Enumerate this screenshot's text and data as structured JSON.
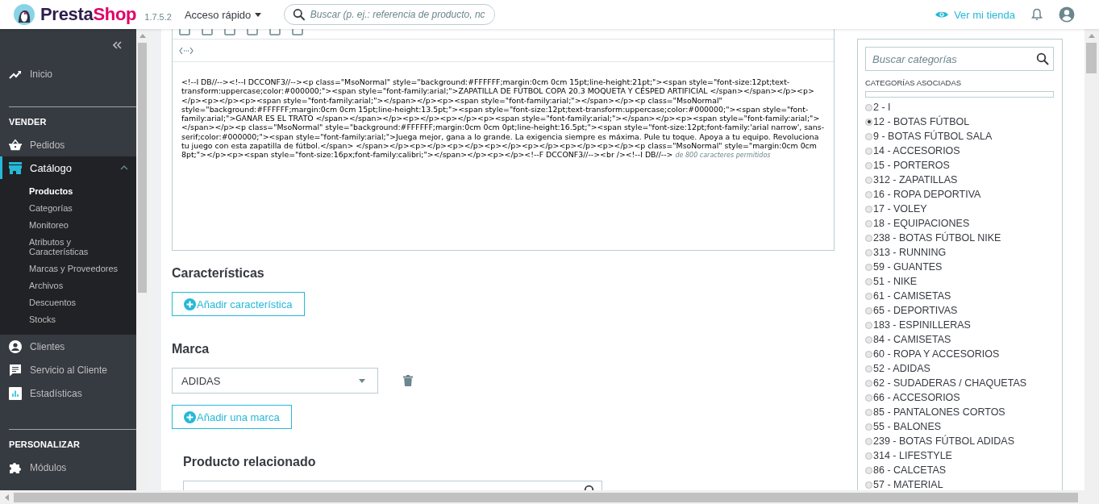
{
  "header": {
    "logo": [
      "Presta",
      "Shop"
    ],
    "version": "1.7.5.2",
    "quick_access": "Acceso rápido",
    "search": {
      "placeholder": "Buscar (p. ej.: referencia de producto, nc"
    },
    "view_store": "Ver mi tienda"
  },
  "sidebar": {
    "top": [
      {
        "label": "Inicio",
        "selected": false
      }
    ],
    "sections": [
      {
        "heading": "VENDER",
        "items": [
          {
            "label": "Pedidos",
            "selected": false,
            "expanded": false
          },
          {
            "label": "Catálogo",
            "selected": true,
            "expanded": true,
            "children": [
              {
                "label": "Productos",
                "selected": true
              },
              {
                "label": "Categorías",
                "selected": false
              },
              {
                "label": "Monitoreo",
                "selected": false
              },
              {
                "label": "Atributos y Características",
                "selected": false
              },
              {
                "label": "Marcas y Proveedores",
                "selected": false
              },
              {
                "label": "Archivos",
                "selected": false
              },
              {
                "label": "Descuentos",
                "selected": false
              },
              {
                "label": "Stocks",
                "selected": false
              }
            ]
          },
          {
            "label": "Clientes",
            "selected": false,
            "expanded": false
          },
          {
            "label": "Servicio al Cliente",
            "selected": false,
            "expanded": false
          },
          {
            "label": "Estadísticas",
            "selected": false,
            "expanded": false
          }
        ]
      },
      {
        "heading": "PERSONALIZAR",
        "items": [
          {
            "label": "Módulos",
            "selected": false,
            "expanded": false
          }
        ]
      }
    ]
  },
  "editor": {
    "source": "<!--I DB//--><!--I DCCONF3//--><p class=\"MsoNormal\" style=\"background:#FFFFFF;margin:0cm 0cm 15pt;line-height:21pt;\"><span style=\"font-size:12pt;text-transform:uppercase;color:#000000;\"><span style=\"font-family:arial;\">ZAPATILLA DE FÚTBOL COPA 20.3 MOQUETA Y CÉSPED ARTIFICIAL </span></span></p><p></p><p></p><p><span style=\"font-family:arial;\"></span></p><p><span style=\"font-family:arial;\"></span></p><p class=\"MsoNormal\" style=\"background:#FFFFFF;margin:0cm 0cm 15pt;line-height:13.5pt;\"><span style=\"font-size:12pt;text-transform:uppercase;color:#000000;\"><span style=\"font-family:arial;\">GANAR ES EL TRATO </span></span></p><p></p><p></p><p><span style=\"font-family:arial;\"></span></p><p><span style=\"font-family:arial;\"></span></p><p class=\"MsoNormal\" style=\"background:#FFFFFF;margin:0cm 0cm 0pt;line-height:16.5pt;\"><span style=\"font-size:12pt;font-family:'arial narrow', sans-serif;color:#000000;\"><span style=\"font-family:arial;\">Juega mejor, gana a lo grande. La exigencia siempre es máxima. Pule tu toque. Apoya a tu equipo. Revoluciona tu juego con esta zapatilla de fútbol.</span> </span></p><p></p><p></p><p></p><p></p><p></p><p></p><p class=\"MsoNormal\" style=\"margin:0cm 0cm 8pt;\"></p><p><span style=\"font-size:16px;font-family:calibri;\"></span></p><p></p><!--F DCCONF3//--><br /><!--I DB//-->",
    "counter": "de 800 caracteres permitidos"
  },
  "features": {
    "title": "Características",
    "add_button": "Añadir característica"
  },
  "brand": {
    "title": "Marca",
    "value": "ADIDAS",
    "add_button": "Añadir una marca"
  },
  "related": {
    "title": "Producto relacionado"
  },
  "categories": {
    "search": {
      "placeholder": "Buscar categorías"
    },
    "heading": "CATEGORÍAS ASOCIADAS",
    "items": [
      {
        "label": "2 - I",
        "selected": false
      },
      {
        "label": "12 - BOTAS FÚTBOL",
        "selected": true
      },
      {
        "label": "9 - BOTAS FÚTBOL SALA",
        "selected": false
      },
      {
        "label": "14 - ACCESORIOS",
        "selected": false
      },
      {
        "label": "15 - PORTEROS",
        "selected": false
      },
      {
        "label": "312 - ZAPATILLAS",
        "selected": false
      },
      {
        "label": "16 - ROPA DEPORTIVA",
        "selected": false
      },
      {
        "label": "17 - VOLEY",
        "selected": false
      },
      {
        "label": "18 - EQUIPACIONES",
        "selected": false
      },
      {
        "label": "238 - BOTAS FÚTBOL NIKE",
        "selected": false
      },
      {
        "label": "313 - RUNNING",
        "selected": false
      },
      {
        "label": "59 - GUANTES",
        "selected": false
      },
      {
        "label": "51 - NIKE",
        "selected": false
      },
      {
        "label": "61 - CAMISETAS",
        "selected": false
      },
      {
        "label": "65 - DEPORTIVAS",
        "selected": false
      },
      {
        "label": "183 - ESPINILLERAS",
        "selected": false
      },
      {
        "label": "84 - CAMISETAS",
        "selected": false
      },
      {
        "label": "60 - ROPA Y ACCESORIOS",
        "selected": false
      },
      {
        "label": "52 - ADIDAS",
        "selected": false
      },
      {
        "label": "62 - SUDADERAS / CHAQUETAS",
        "selected": false
      },
      {
        "label": "66 - ACCESORIOS",
        "selected": false
      },
      {
        "label": "85 - PANTALONES CORTOS",
        "selected": false
      },
      {
        "label": "55 - BALONES",
        "selected": false
      },
      {
        "label": "239 - BOTAS FÚTBOL ADIDAS",
        "selected": false
      },
      {
        "label": "314 - LIFESTYLE",
        "selected": false
      },
      {
        "label": "86 - CALCETAS",
        "selected": false
      },
      {
        "label": "57 - MATERIAL",
        "selected": false
      }
    ]
  }
}
